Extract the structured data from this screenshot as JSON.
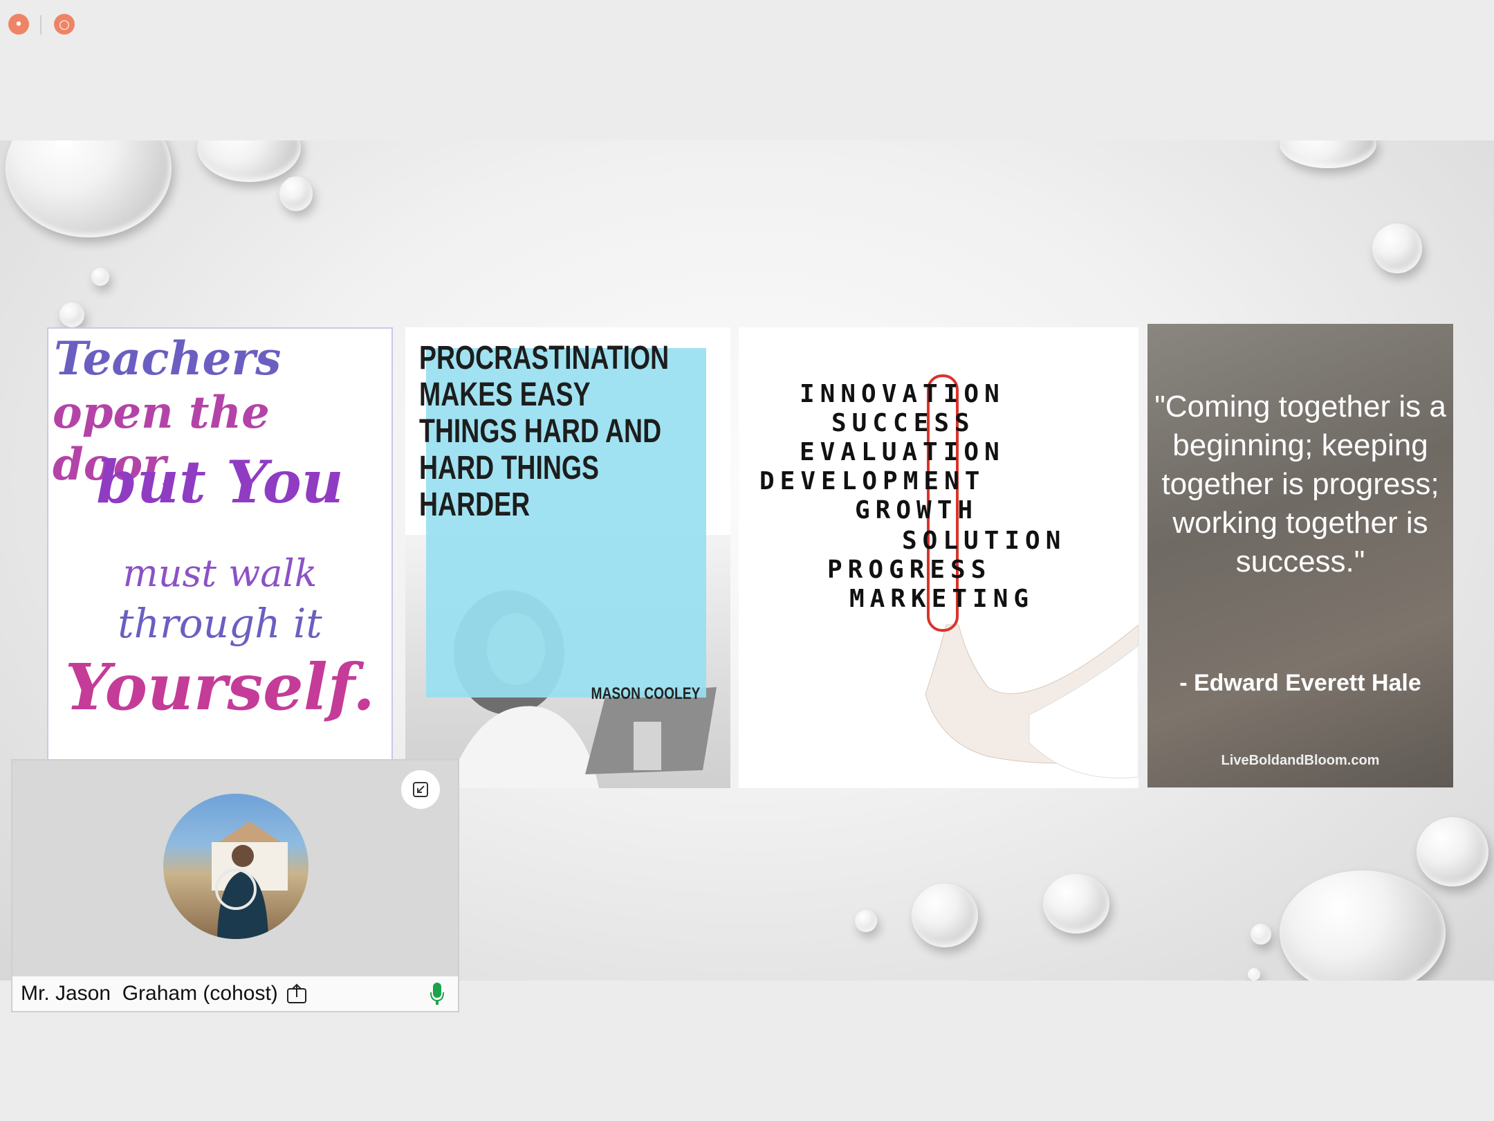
{
  "window": {
    "controls": [
      {
        "name": "record",
        "glyph": "•"
      },
      {
        "name": "stop",
        "glyph": "○"
      }
    ]
  },
  "slide": {
    "panel1": {
      "lines": [
        "Teachers",
        "open the door,",
        "but You",
        "must walk",
        "through it",
        "Yourself."
      ]
    },
    "panel2": {
      "headline": [
        "PROCRASTINATION",
        "MAKES EASY",
        "THINGS HARD AND",
        "HARD THINGS",
        "HARDER"
      ],
      "author": "MASON COOLEY"
    },
    "panel3": {
      "words": [
        "INNOVATION",
        "SUCCESS",
        "EVALUATION",
        "DEVELOPMENT",
        "GROWTH",
        "SOLUTION",
        "PROGRESS",
        "MARKETING"
      ]
    },
    "panel4": {
      "quote": "\"Coming together is a beginning; keeping together is progress; working together is success.\"",
      "attribution": "- Edward Everett Hale",
      "site": "LiveBoldandBloom.com"
    }
  },
  "participant": {
    "name": "Mr. Jason  Graham (cohost)",
    "mic_status": "unmuted",
    "icons": [
      "share-screen-icon",
      "microphone-icon",
      "minimize-icon"
    ]
  }
}
